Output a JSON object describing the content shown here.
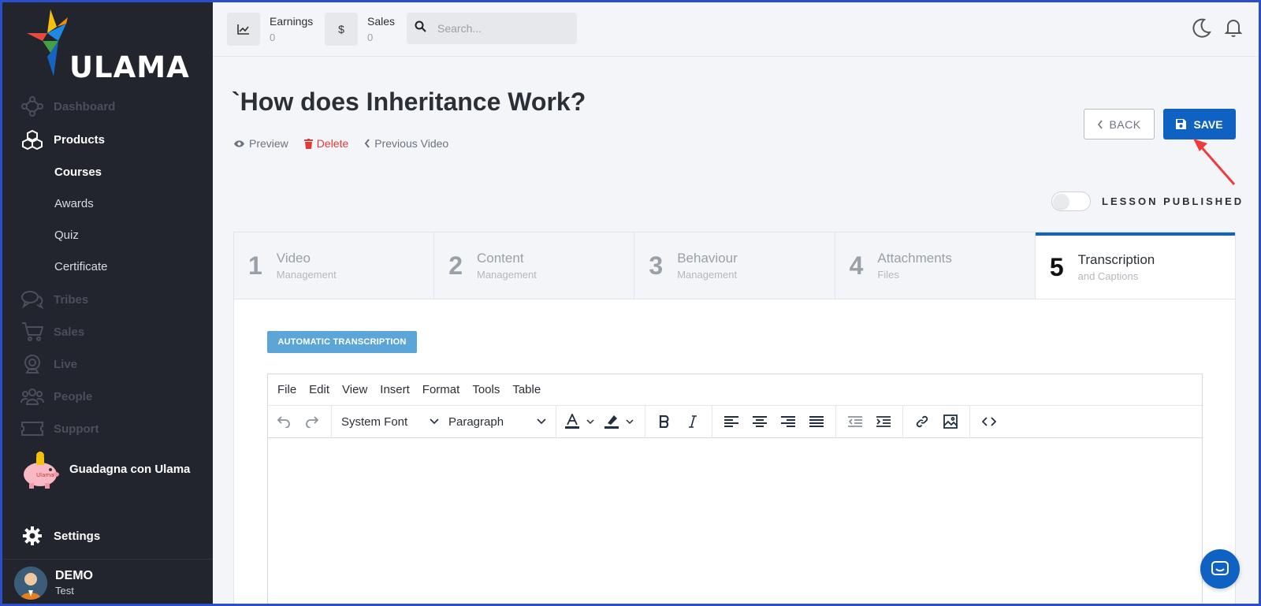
{
  "brand": {
    "name": "ULAMA"
  },
  "sidebar": {
    "items": [
      {
        "label": "Dashboard",
        "icon": "network-icon"
      },
      {
        "label": "Products",
        "icon": "cubes-icon"
      },
      {
        "label": "Tribes",
        "icon": "chat-bubbles-icon"
      },
      {
        "label": "Sales",
        "icon": "cart-icon"
      },
      {
        "label": "Live",
        "icon": "webcam-icon"
      },
      {
        "label": "People",
        "icon": "people-icon"
      },
      {
        "label": "Support",
        "icon": "ticket-icon"
      }
    ],
    "subitems": [
      "Courses",
      "Awards",
      "Quiz",
      "Certificate"
    ],
    "promo_label": "Guadagna con Ulama",
    "settings_label": "Settings",
    "user": {
      "name": "DEMO",
      "role": "Test"
    }
  },
  "topbar": {
    "earnings": {
      "label": "Earnings",
      "value": "0"
    },
    "sales": {
      "label": "Sales",
      "value": "0",
      "icon_text": "$"
    },
    "search_placeholder": "Search..."
  },
  "page": {
    "title": "`How does Inheritance Work?",
    "actions": {
      "preview": "Preview",
      "delete": "Delete",
      "previous": "Previous Video"
    },
    "back_label": "BACK",
    "save_label": "SAVE",
    "published_label": "LESSON PUBLISHED",
    "published": false
  },
  "steps": [
    {
      "num": "1",
      "label": "Video",
      "sub": "Management"
    },
    {
      "num": "2",
      "label": "Content",
      "sub": "Management"
    },
    {
      "num": "3",
      "label": "Behaviour",
      "sub": "Management"
    },
    {
      "num": "4",
      "label": "Attachments",
      "sub": "Files"
    },
    {
      "num": "5",
      "label": "Transcription",
      "sub": "and Captions"
    }
  ],
  "active_step": 5,
  "editor": {
    "auto_button": "AUTOMATIC TRANSCRIPTION",
    "menu": [
      "File",
      "Edit",
      "View",
      "Insert",
      "Format",
      "Tools",
      "Table"
    ],
    "font_select": "System Font",
    "block_select": "Paragraph"
  },
  "colors": {
    "accent": "#0f62c2",
    "danger": "#e53935",
    "sidebar_bg": "#22252d"
  }
}
